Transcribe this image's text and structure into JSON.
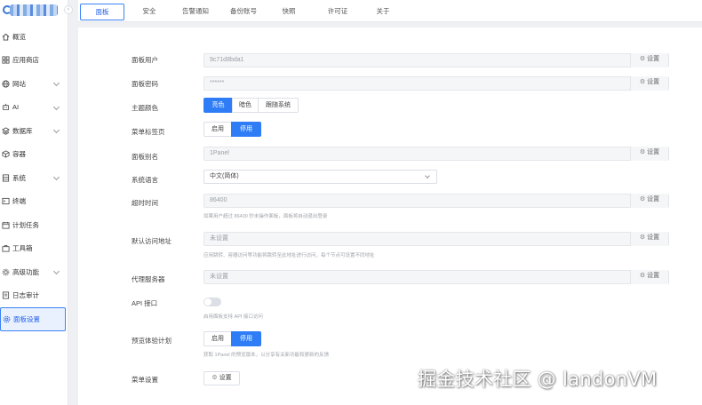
{
  "sidebar": {
    "collapse_glyph": "‹",
    "items": [
      {
        "label": "概览",
        "icon": "home-icon"
      },
      {
        "label": "应用商店",
        "icon": "grid-icon"
      },
      {
        "label": "网站",
        "icon": "globe-icon",
        "expandable": true
      },
      {
        "label": "AI",
        "icon": "robot-icon",
        "expandable": true
      },
      {
        "label": "数据库",
        "icon": "layers-icon",
        "expandable": true
      },
      {
        "label": "容器",
        "icon": "cube-icon"
      },
      {
        "label": "系统",
        "icon": "server-icon",
        "expandable": true
      },
      {
        "label": "终端",
        "icon": "terminal-icon"
      },
      {
        "label": "计划任务",
        "icon": "calendar-icon"
      },
      {
        "label": "工具箱",
        "icon": "toolbox-icon"
      },
      {
        "label": "高级功能",
        "icon": "gear-star-icon",
        "expandable": true
      },
      {
        "label": "日志审计",
        "icon": "log-icon"
      },
      {
        "label": "面板设置",
        "icon": "settings-icon",
        "active": true
      }
    ]
  },
  "tabs": [
    {
      "label": "面板",
      "active": true
    },
    {
      "label": "安全"
    },
    {
      "label": "告警通知"
    },
    {
      "label": "备份账号"
    },
    {
      "label": "快照"
    },
    {
      "label": "许可证"
    },
    {
      "label": "关于"
    }
  ],
  "settings": {
    "set_label": "设置",
    "user": {
      "label": "面板用户",
      "value": "9c71d8bda1"
    },
    "password": {
      "label": "面板密码",
      "value": "******"
    },
    "theme": {
      "label": "主题颜色",
      "options": [
        "亮色",
        "暗色",
        "跟随系统"
      ],
      "selected": "亮色"
    },
    "menu_tabs": {
      "label": "菜单标签页",
      "options": [
        "启用",
        "停用"
      ],
      "selected": "停用"
    },
    "alias": {
      "label": "面板别名",
      "value": "1Panel"
    },
    "language": {
      "label": "系统语言",
      "value": "中文(简体)"
    },
    "timeout": {
      "label": "超时时间",
      "value": "86400",
      "hint": "如果用户超过 86400 秒未操作面板，面板将自动退出登录"
    },
    "default_url": {
      "label": "默认访问地址",
      "value": "未设置",
      "hint": "应用跳转、容器访问等功能将跳转至此地址进行访问，每个节点可设置不同地址"
    },
    "proxy": {
      "label": "代理服务器",
      "value": "未设置"
    },
    "api": {
      "label": "API 接口",
      "enabled": false,
      "hint": "启用面板支持 API 接口访问"
    },
    "preview": {
      "label": "预览体验计划",
      "options": [
        "启用",
        "停用"
      ],
      "selected": "停用",
      "hint": "获取 1Panel 的预览版本，以分享有关新功能和更新的反馈"
    },
    "menu_settings": {
      "label": "菜单设置"
    }
  },
  "watermark": "掘金技术社区 @ landonVM"
}
